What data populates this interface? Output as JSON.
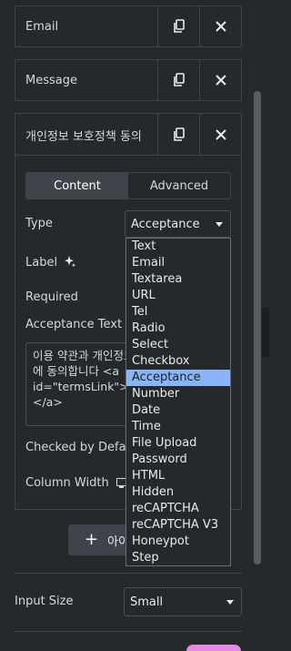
{
  "repeater": {
    "rows": [
      {
        "title": "Email"
      },
      {
        "title": "Message"
      },
      {
        "title": "개인정보 보호정책 동의"
      }
    ]
  },
  "tabs": {
    "content": "Content",
    "advanced": "Advanced"
  },
  "fields": {
    "type_label": "Type",
    "type_value": "Acceptance",
    "label_label": "Label",
    "required_label": "Required",
    "acceptance_text_label": "Acceptance Text",
    "acceptance_text_lines": [
      "이용 약관과 개인정보",
      "에 동의합니다 <a",
      "id=\"termsLink\">[약",
      "</a>"
    ],
    "checked_by_default_label": "Checked by Default",
    "column_width_label": "Column Width"
  },
  "type_options": [
    "Text",
    "Email",
    "Textarea",
    "URL",
    "Tel",
    "Radio",
    "Select",
    "Checkbox",
    "Acceptance",
    "Number",
    "Date",
    "Time",
    "File Upload",
    "Password",
    "HTML",
    "Hidden",
    "reCAPTCHA",
    "reCAPTCHA V3",
    "Honeypot",
    "Step"
  ],
  "selected_option_index": 8,
  "add_item_label": "아이템 추가",
  "input_size": {
    "label": "Input Size",
    "value": "Small"
  },
  "colors": {
    "background": "#26292c",
    "border": "#3f4246",
    "active_tab": "#3f444b",
    "highlight": "#8ab4f8",
    "text": "#d5d8dc"
  }
}
